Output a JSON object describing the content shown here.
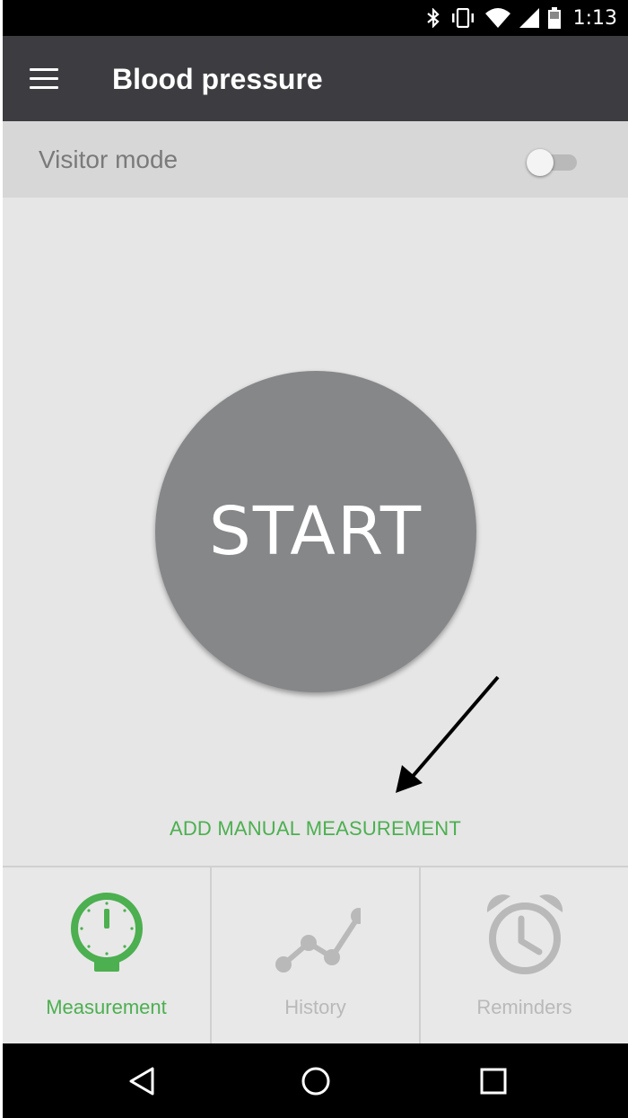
{
  "status_bar": {
    "time": "1:13",
    "icons": [
      "bluetooth-icon",
      "vibrate-icon",
      "wifi-icon",
      "cell-signal-icon",
      "battery-icon"
    ]
  },
  "app_bar": {
    "title": "Blood pressure",
    "menu_icon": "hamburger-menu-icon"
  },
  "visitor_mode": {
    "label": "Visitor mode",
    "enabled": false
  },
  "main": {
    "start_label": "START",
    "manual_link": "ADD MANUAL MEASUREMENT"
  },
  "tabs": [
    {
      "label": "Measurement",
      "icon": "gauge-icon",
      "active": true
    },
    {
      "label": "History",
      "icon": "line-graph-icon",
      "active": false
    },
    {
      "label": "Reminders",
      "icon": "alarm-clock-icon",
      "active": false
    }
  ],
  "nav": [
    "back-icon",
    "home-icon",
    "recents-icon"
  ],
  "colors": {
    "accent": "#4caf50",
    "app_bar": "#3d3d41",
    "start_button": "#868789",
    "inactive": "#b9b9b9"
  }
}
